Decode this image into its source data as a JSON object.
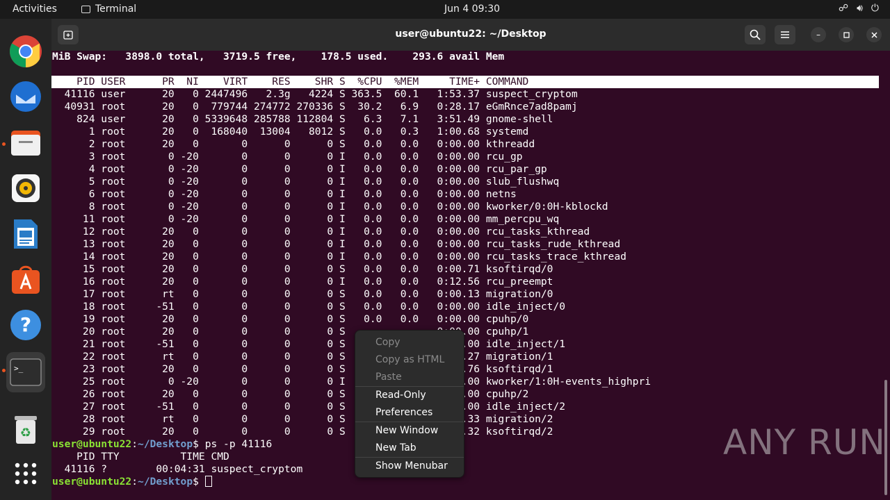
{
  "topbar": {
    "activities": "Activities",
    "app_name": "Terminal",
    "clock": "Jun 4  09:30"
  },
  "window": {
    "title": "user@ubuntu22: ~/Desktop"
  },
  "terminal": {
    "swap_line": "MiB Swap:   3898.0 total,   3719.5 free,    178.5 used.    293.6 avail Mem",
    "header_line": "    PID USER      PR  NI    VIRT    RES    SHR S  %CPU  %MEM     TIME+ COMMAND",
    "rows": [
      "  41116 user      20   0 2447496   2.3g   4224 S 363.5  60.1   1:53.37 suspect_cryptom",
      "  40931 root      20   0  779744 274772 270336 S  30.2   6.9   0:28.17 eGmRnce7ad8pamj",
      "    824 user      20   0 5339648 285788 112804 S   6.3   7.1   3:51.49 gnome-shell",
      "      1 root      20   0  168040  13004   8012 S   0.0   0.3   1:00.68 systemd",
      "      2 root      20   0       0      0      0 S   0.0   0.0   0:00.00 kthreadd",
      "      3 root       0 -20       0      0      0 I   0.0   0.0   0:00.00 rcu_gp",
      "      4 root       0 -20       0      0      0 I   0.0   0.0   0:00.00 rcu_par_gp",
      "      5 root       0 -20       0      0      0 I   0.0   0.0   0:00.00 slub_flushwq",
      "      6 root       0 -20       0      0      0 I   0.0   0.0   0:00.00 netns",
      "      8 root       0 -20       0      0      0 I   0.0   0.0   0:00.00 kworker/0:0H-kblockd",
      "     11 root       0 -20       0      0      0 I   0.0   0.0   0:00.00 mm_percpu_wq",
      "     12 root      20   0       0      0      0 I   0.0   0.0   0:00.00 rcu_tasks_kthread",
      "     13 root      20   0       0      0      0 I   0.0   0.0   0:00.00 rcu_tasks_rude_kthread",
      "     14 root      20   0       0      0      0 I   0.0   0.0   0:00.00 rcu_tasks_trace_kthread",
      "     15 root      20   0       0      0      0 S   0.0   0.0   0:00.71 ksoftirqd/0",
      "     16 root      20   0       0      0      0 I   0.0   0.0   0:12.56 rcu_preempt",
      "     17 root      rt   0       0      0      0 S   0.0   0.0   0:00.13 migration/0",
      "     18 root     -51   0       0      0      0 S   0.0   0.0   0:00.00 idle_inject/0",
      "     19 root      20   0       0      0      0 S   0.0   0.0   0:00.00 cpuhp/0",
      "     20 root      20   0       0      0      0 S               0:00.00 cpuhp/1",
      "     21 root     -51   0       0      0      0 S               0:00.00 idle_inject/1",
      "     22 root      rt   0       0      0      0 S               0:00.27 migration/1",
      "     23 root      20   0       0      0      0 S               0:00.76 ksoftirqd/1",
      "     25 root       0 -20       0      0      0 I               0:00.00 kworker/1:0H-events_highpri",
      "     26 root      20   0       0      0      0 S               0:00.00 cpuhp/2",
      "     27 root     -51   0       0      0      0 S               0:00.00 idle_inject/2",
      "     28 root      rt   0       0      0      0 S               0:00.33 migration/2",
      "     29 root      20   0       0      0      0 S               0:00.32 ksoftirqd/2"
    ],
    "prompt_user": "user@ubuntu22",
    "prompt_sep": ":",
    "prompt_path": "~/Desktop",
    "prompt_dollar": "$ ",
    "command1": "ps -p 41116",
    "ps_header": "    PID TTY          TIME CMD",
    "ps_row": "  41116 ?        00:04:31 suspect_cryptom"
  },
  "context_menu": {
    "copy": "Copy",
    "copy_html": "Copy as HTML",
    "paste": "Paste",
    "read_only": "Read-Only",
    "preferences": "Preferences",
    "new_window": "New Window",
    "new_tab": "New Tab",
    "show_menubar": "Show Menubar"
  },
  "watermark": "ANY RUN",
  "colors": {
    "terminal_bg": "#300a24",
    "prompt_user": "#8ae234",
    "prompt_path": "#729fcf",
    "accent": "#e95420"
  }
}
